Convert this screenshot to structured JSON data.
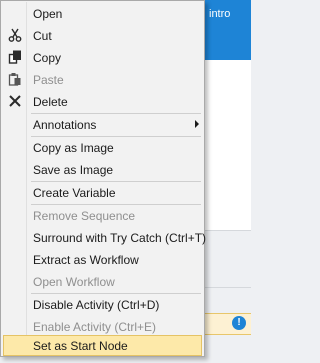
{
  "background": {
    "header_text": "intro",
    "warning_icon_glyph": "!",
    "accent_color": "#1e84d6"
  },
  "menu": {
    "items": [
      {
        "label": "Open",
        "enabled": true,
        "icon": ""
      },
      {
        "label": "Cut",
        "enabled": true,
        "icon": "scissors-icon"
      },
      {
        "label": "Copy",
        "enabled": true,
        "icon": "copy-icon"
      },
      {
        "label": "Paste",
        "enabled": false,
        "icon": "paste-icon"
      },
      {
        "label": "Delete",
        "enabled": true,
        "icon": "delete-x-icon"
      },
      {
        "label": "Annotations",
        "enabled": true,
        "icon": "",
        "submenu": true
      },
      {
        "label": "Copy as Image",
        "enabled": true,
        "icon": ""
      },
      {
        "label": "Save as Image",
        "enabled": true,
        "icon": ""
      },
      {
        "label": "Create Variable",
        "enabled": true,
        "icon": ""
      },
      {
        "label": "Remove Sequence",
        "enabled": false,
        "icon": ""
      },
      {
        "label": "Surround with Try Catch (Ctrl+T)",
        "enabled": true,
        "icon": ""
      },
      {
        "label": "Extract as Workflow",
        "enabled": true,
        "icon": ""
      },
      {
        "label": "Open Workflow",
        "enabled": false,
        "icon": ""
      },
      {
        "label": "Disable Activity (Ctrl+D)",
        "enabled": true,
        "icon": ""
      },
      {
        "label": "Enable Activity (Ctrl+E)",
        "enabled": false,
        "icon": ""
      },
      {
        "label": "Set as Start Node",
        "enabled": true,
        "icon": "",
        "highlighted": true
      }
    ],
    "highlight_color": "#fde9a9"
  }
}
